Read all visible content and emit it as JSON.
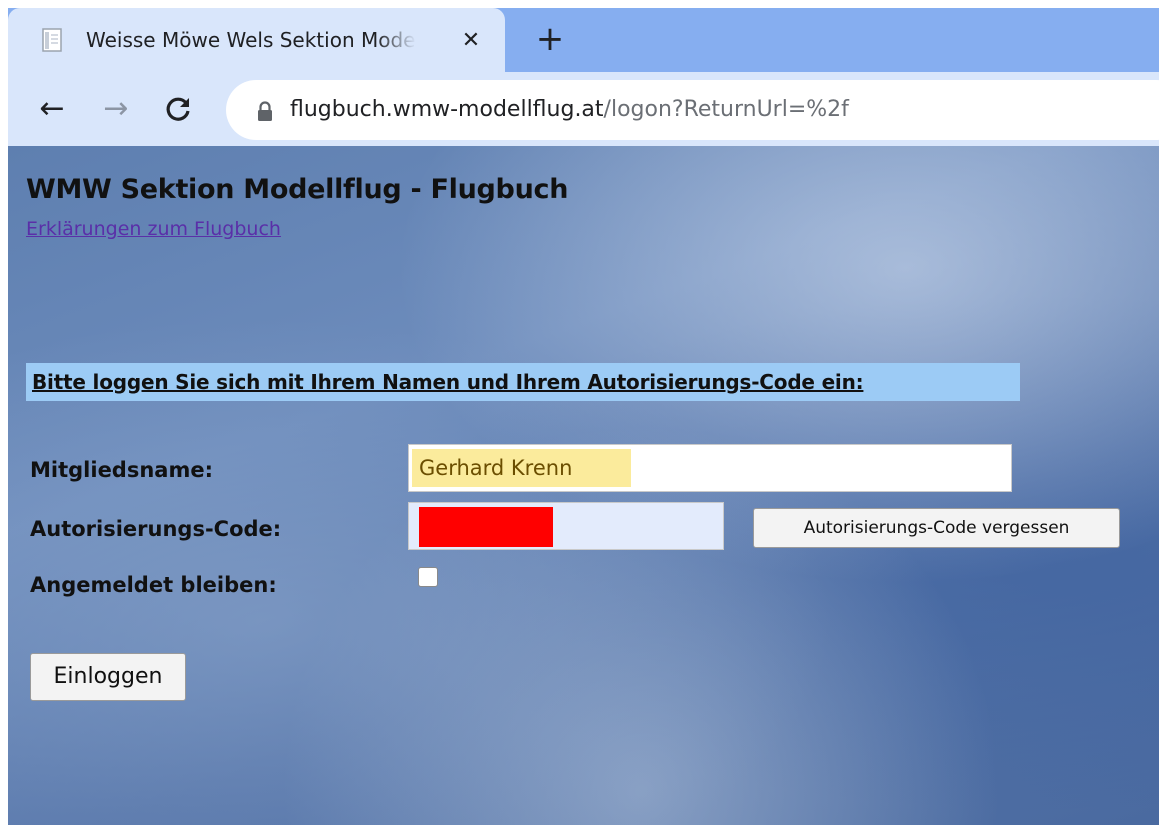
{
  "browser": {
    "tab": {
      "title": "Weisse Möwe Wels Sektion Modellflug - Flugbuch",
      "close_glyph": "✕",
      "favicon": "document-icon"
    },
    "new_tab_glyph": "+",
    "nav": {
      "back_glyph": "←",
      "forward_glyph": "→",
      "reload_glyph": "C"
    },
    "address": {
      "host": "flugbuch.wmw-modellflug.at",
      "path": "/logon?ReturnUrl=%2f",
      "secure_icon": "lock-icon"
    }
  },
  "page": {
    "title": "WMW Sektion Modellflug - Flugbuch",
    "help_link": "Erklärungen zum Flugbuch",
    "instruction": "Bitte loggen Sie sich mit Ihrem Namen und Ihrem Autorisierungs-Code ein:",
    "form": {
      "name_label": "Mitgliedsname:",
      "name_value": "Gerhard Krenn",
      "code_label": "Autorisierungs-Code:",
      "forgot_button": "Autorisierungs-Code vergessen",
      "stay_label": "Angemeldet bleiben:",
      "stay_checked": false,
      "login_button": "Einloggen"
    }
  },
  "colors": {
    "tabstrip": "#86aef0",
    "toolbar": "#d9e6fb",
    "instruction_highlight": "#9ccbf5",
    "autofill_yellow": "#fbeb9c",
    "autofill_blue": "#e3ebfc",
    "redaction": "#ff0000",
    "link": "#5a2fa8"
  }
}
